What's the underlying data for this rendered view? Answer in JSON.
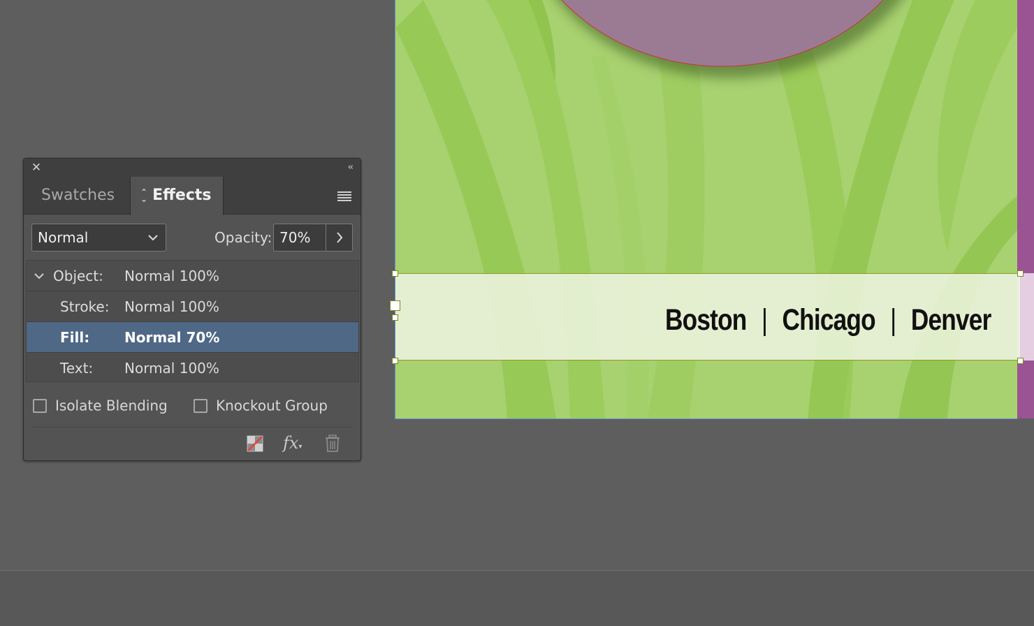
{
  "panel": {
    "tabs": [
      {
        "label": "Swatches"
      },
      {
        "label": "Effects"
      }
    ],
    "blend_mode": "Normal",
    "opacity_label": "Opacity:",
    "opacity_value": "70%",
    "levels": [
      {
        "name": "Object:",
        "value": "Normal 100%"
      },
      {
        "name": "Stroke:",
        "value": "Normal 100%"
      },
      {
        "name": "Fill:",
        "value": "Normal 70%"
      },
      {
        "name": "Text:",
        "value": "Normal 100%"
      }
    ],
    "selected_level": "Fill:",
    "checkboxes": [
      {
        "label": "Isolate Blending",
        "checked": false
      },
      {
        "label": "Knockout Group",
        "checked": false
      }
    ],
    "footer_icons": [
      "clear-effects-icon",
      "fx-icon",
      "trash-icon"
    ]
  },
  "canvas": {
    "banner_cities": [
      "Boston",
      "Chicago",
      "Denver"
    ],
    "separator": "|",
    "colors": {
      "page_green": "#a8d170",
      "circle_purple": "#9b7b93",
      "bleed_purple": "#9a5493",
      "banner_fill": "#eef5e2",
      "selected_row": "#4e6886"
    }
  }
}
